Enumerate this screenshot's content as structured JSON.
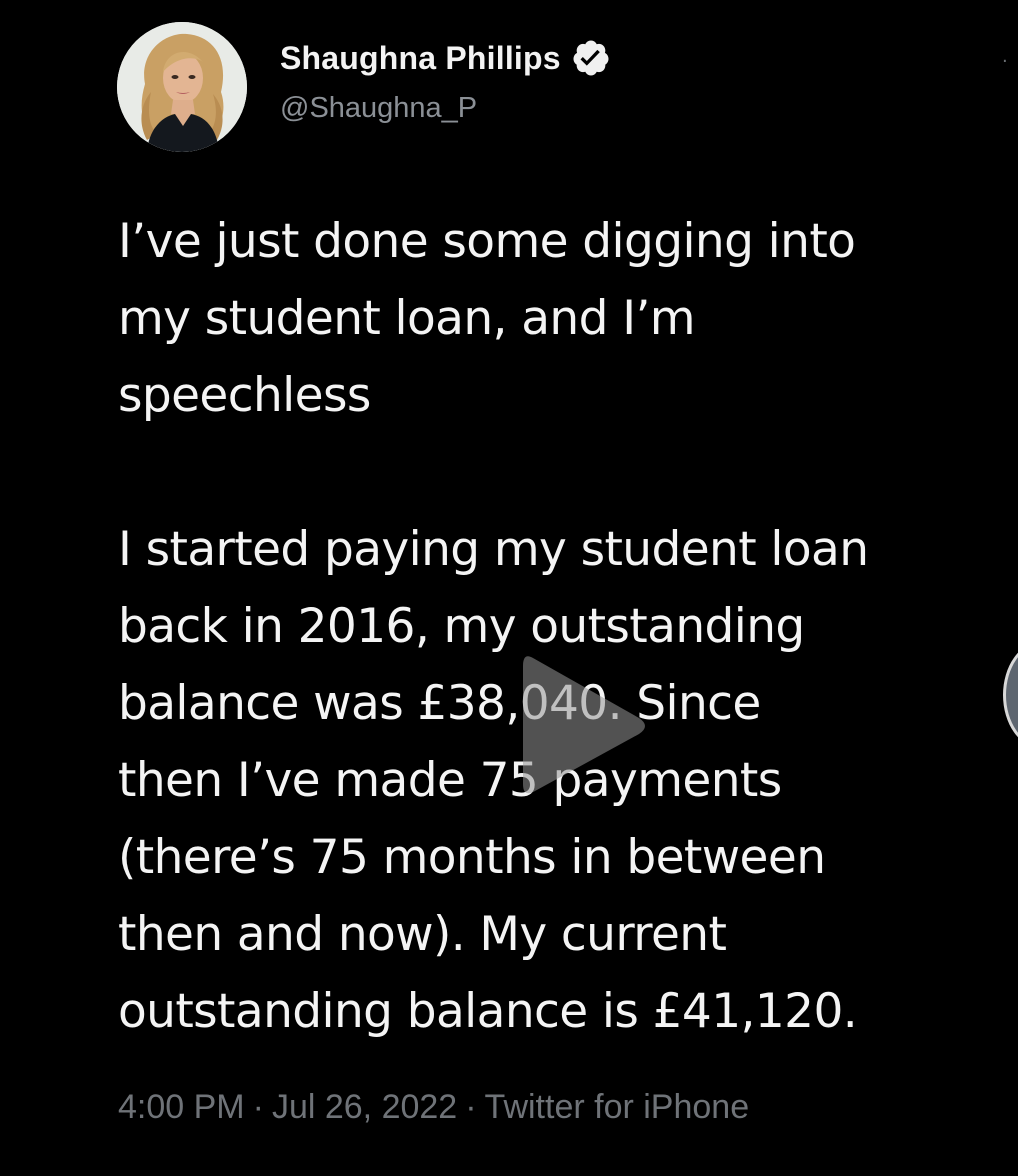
{
  "tweet": {
    "author": {
      "display_name": "Shaughna Phillips",
      "handle": "@Shaughna_P",
      "verified": true,
      "avatar_icon": "profile-avatar"
    },
    "text_lines": [
      "I’ve just done some digging into",
      "my student loan, and I’m",
      "speechless",
      "",
      "I started paying my student loan",
      "back in 2016, my outstanding",
      "balance was £38,040. Since",
      "then I’ve made 75 payments",
      "(there’s 75 months in between",
      "then and now). My current",
      "outstanding balance is £41,120."
    ],
    "meta": {
      "time": "4:00 PM",
      "date": "Jul 26, 2022",
      "source": "Twitter for iPhone"
    }
  },
  "colors": {
    "background": "#000000",
    "text": "#f4f4f4",
    "secondary_text": "#8b9096",
    "meta_text": "#6f7378",
    "verified_badge": "#f0f0f0"
  },
  "icons": {
    "verified": "verified-badge-icon",
    "play": "play-icon",
    "more": "more-options-icon"
  }
}
